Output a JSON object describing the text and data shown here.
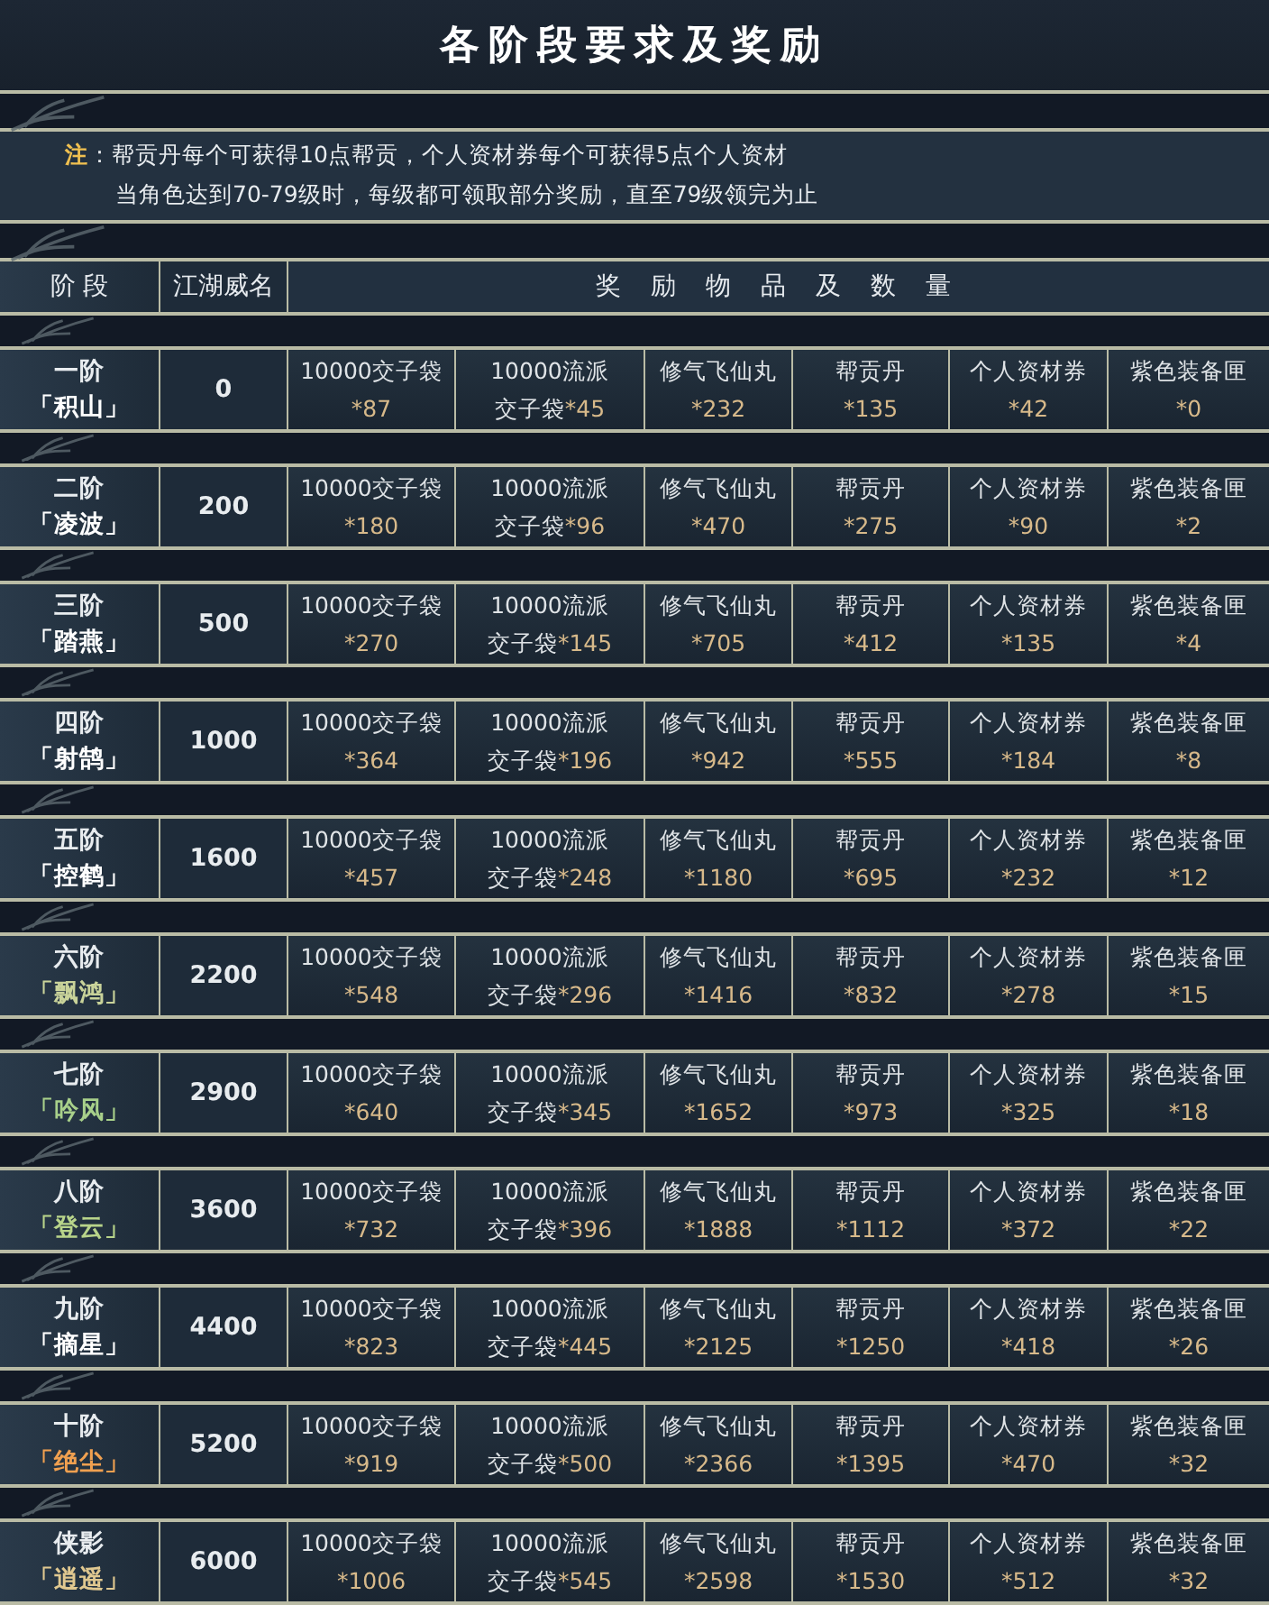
{
  "title": "各阶段要求及奖励",
  "note": {
    "label": "注",
    "lines": [
      "：帮贡丹每个可获得10点帮贡，个人资材券每个可获得5点个人资材",
      "当角色达到70-79级时，每级都可领取部分奖励，直至79级领完为止"
    ]
  },
  "header": {
    "stage": "阶 段",
    "rank": "江湖威名",
    "rewards": "奖 励 物 品 及 数 量"
  },
  "rows": [
    {
      "stage": "一阶",
      "name": "「积山」",
      "color": "#ffffff",
      "rank": "0",
      "rewards": [
        {
          "name": "10000交子袋",
          "qty": "*87"
        },
        {
          "name": "10000流派",
          "suffix": "交子袋",
          "qty": "*45"
        },
        {
          "name": "修气飞仙丸",
          "qty": "*232"
        },
        {
          "name": "帮贡丹",
          "qty": "*135"
        },
        {
          "name": "个人资材券",
          "qty": "*42"
        },
        {
          "name": "紫色装备匣",
          "qty": "*0"
        }
      ]
    },
    {
      "stage": "二阶",
      "name": "「凌波」",
      "color": "#ffffff",
      "rank": "200",
      "rewards": [
        {
          "name": "10000交子袋",
          "qty": "*180"
        },
        {
          "name": "10000流派",
          "suffix": "交子袋",
          "qty": "*96"
        },
        {
          "name": "修气飞仙丸",
          "qty": "*470"
        },
        {
          "name": "帮贡丹",
          "qty": "*275"
        },
        {
          "name": "个人资材券",
          "qty": "*90"
        },
        {
          "name": "紫色装备匣",
          "qty": "*2"
        }
      ]
    },
    {
      "stage": "三阶",
      "name": "「踏燕」",
      "color": "#ffffff",
      "rank": "500",
      "rewards": [
        {
          "name": "10000交子袋",
          "qty": "*270"
        },
        {
          "name": "10000流派",
          "suffix": "交子袋",
          "qty": "*145"
        },
        {
          "name": "修气飞仙丸",
          "qty": "*705"
        },
        {
          "name": "帮贡丹",
          "qty": "*412"
        },
        {
          "name": "个人资材券",
          "qty": "*135"
        },
        {
          "name": "紫色装备匣",
          "qty": "*4"
        }
      ]
    },
    {
      "stage": "四阶",
      "name": "「射鹄」",
      "color": "#ffffff",
      "rank": "1000",
      "rewards": [
        {
          "name": "10000交子袋",
          "qty": "*364"
        },
        {
          "name": "10000流派",
          "suffix": "交子袋",
          "qty": "*196"
        },
        {
          "name": "修气飞仙丸",
          "qty": "*942"
        },
        {
          "name": "帮贡丹",
          "qty": "*555"
        },
        {
          "name": "个人资材券",
          "qty": "*184"
        },
        {
          "name": "紫色装备匣",
          "qty": "*8"
        }
      ]
    },
    {
      "stage": "五阶",
      "name": "「控鹤」",
      "color": "#ffffff",
      "rank": "1600",
      "rewards": [
        {
          "name": "10000交子袋",
          "qty": "*457"
        },
        {
          "name": "10000流派",
          "suffix": "交子袋",
          "qty": "*248"
        },
        {
          "name": "修气飞仙丸",
          "qty": "*1180"
        },
        {
          "name": "帮贡丹",
          "qty": "*695"
        },
        {
          "name": "个人资材券",
          "qty": "*232"
        },
        {
          "name": "紫色装备匣",
          "qty": "*12"
        }
      ]
    },
    {
      "stage": "六阶",
      "name": "「飘鸿」",
      "color": "#c9d39a",
      "rank": "2200",
      "rewards": [
        {
          "name": "10000交子袋",
          "qty": "*548"
        },
        {
          "name": "10000流派",
          "suffix": "交子袋",
          "qty": "*296"
        },
        {
          "name": "修气飞仙丸",
          "qty": "*1416"
        },
        {
          "name": "帮贡丹",
          "qty": "*832"
        },
        {
          "name": "个人资材券",
          "qty": "*278"
        },
        {
          "name": "紫色装备匣",
          "qty": "*15"
        }
      ]
    },
    {
      "stage": "七阶",
      "name": "「吟风」",
      "color": "#a8d08a",
      "rank": "2900",
      "rewards": [
        {
          "name": "10000交子袋",
          "qty": "*640"
        },
        {
          "name": "10000流派",
          "suffix": "交子袋",
          "qty": "*345"
        },
        {
          "name": "修气飞仙丸",
          "qty": "*1652"
        },
        {
          "name": "帮贡丹",
          "qty": "*973"
        },
        {
          "name": "个人资材券",
          "qty": "*325"
        },
        {
          "name": "紫色装备匣",
          "qty": "*18"
        }
      ]
    },
    {
      "stage": "八阶",
      "name": "「登云」",
      "color": "#b8d48a",
      "rank": "3600",
      "rewards": [
        {
          "name": "10000交子袋",
          "qty": "*732"
        },
        {
          "name": "10000流派",
          "suffix": "交子袋",
          "qty": "*396"
        },
        {
          "name": "修气飞仙丸",
          "qty": "*1888"
        },
        {
          "name": "帮贡丹",
          "qty": "*1112"
        },
        {
          "name": "个人资材券",
          "qty": "*372"
        },
        {
          "name": "紫色装备匣",
          "qty": "*22"
        }
      ]
    },
    {
      "stage": "九阶",
      "name": "「摘星」",
      "color": "#ffffff",
      "rank": "4400",
      "rewards": [
        {
          "name": "10000交子袋",
          "qty": "*823"
        },
        {
          "name": "10000流派",
          "suffix": "交子袋",
          "qty": "*445"
        },
        {
          "name": "修气飞仙丸",
          "qty": "*2125"
        },
        {
          "name": "帮贡丹",
          "qty": "*1250"
        },
        {
          "name": "个人资材券",
          "qty": "*418"
        },
        {
          "name": "紫色装备匣",
          "qty": "*26"
        }
      ]
    },
    {
      "stage": "十阶",
      "name": "「绝尘」",
      "color": "#f0a050",
      "rank": "5200",
      "rewards": [
        {
          "name": "10000交子袋",
          "qty": "*919"
        },
        {
          "name": "10000流派",
          "suffix": "交子袋",
          "qty": "*500"
        },
        {
          "name": "修气飞仙丸",
          "qty": "*2366"
        },
        {
          "name": "帮贡丹",
          "qty": "*1395"
        },
        {
          "name": "个人资材券",
          "qty": "*470"
        },
        {
          "name": "紫色装备匣",
          "qty": "*32"
        }
      ]
    },
    {
      "stage": "侠影",
      "name": "「逍遥」",
      "color": "#e0c890",
      "rank": "6000",
      "rewards": [
        {
          "name": "10000交子袋",
          "qty": "*1006"
        },
        {
          "name": "10000流派",
          "suffix": "交子袋",
          "qty": "*545"
        },
        {
          "name": "修气飞仙丸",
          "qty": "*2598"
        },
        {
          "name": "帮贡丹",
          "qty": "*1530"
        },
        {
          "name": "个人资材券",
          "qty": "*512"
        },
        {
          "name": "紫色装备匣",
          "qty": "*32"
        }
      ]
    }
  ]
}
